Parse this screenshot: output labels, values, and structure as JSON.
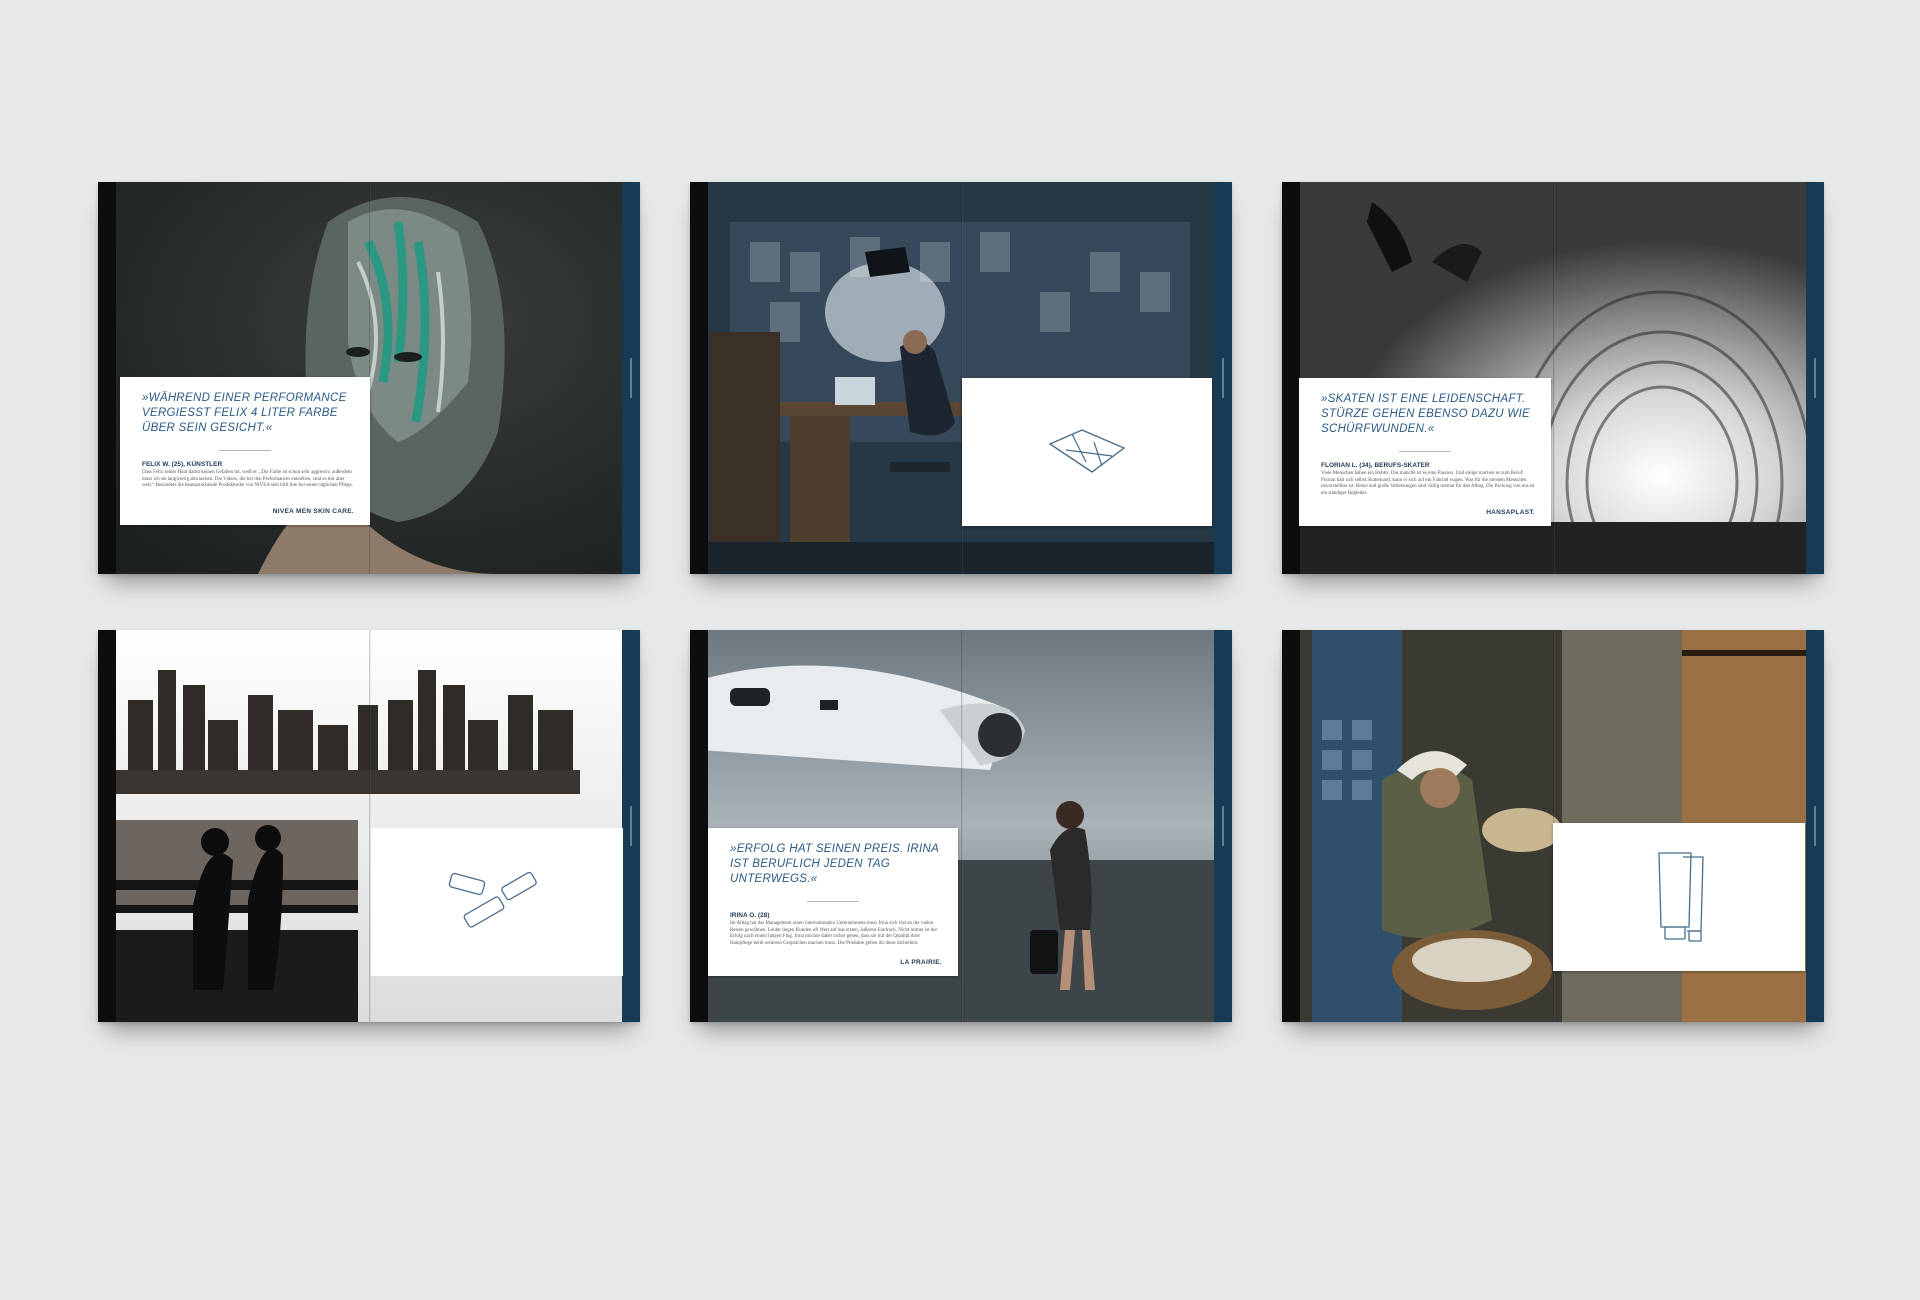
{
  "spreads": [
    {
      "quote": "»Während einer Performance vergiesst Felix 4 Liter Farbe über sein Gesicht.«",
      "who": "FELIX W. (25), KÜNSTLER",
      "body": "Dass Felix seiner Haut damit keinen Gefallen tut, weiß er. „Die Farbe ist schon sehr aggressiv, außerdem muss ich sie langwierig abwaschen. Die Videos, die bei den Performances entstehen, sind es mir aber wert.“ Besonders die beanspruchende Produktreihe von NIVEA sein hilft ihm bei seiner täglichen Pflege.",
      "brand": "NIVEA MEN SKIN CARE.",
      "icon": "none"
    },
    {
      "icon": "folded-paper-icon"
    },
    {
      "quote": "»Skaten ist eine Leidenschaft. Stürze gehen ebenso dazu wie Schürfwunden.«",
      "who": "FLORIAN L. (34), BERUFS-SKATER",
      "body": "Viele Menschen haben ein Hobby. Das manche ist es eine Passion. Und einige machen es zum Beruf: Florian hält sich selbst Skateboard, kann er sich auf ein Fahrrad wagen. Was für die meisten Menschen unvorstellbar ist: Beine und große Verletzungen sind völlig normal für den Alltag. Die Packung von uns ist ein ständiger Begleiter.",
      "brand": "HANSAPLAST.",
      "icon": "none"
    },
    {
      "icon": "lip-balm-sticks-icon"
    },
    {
      "quote": "»Erfolg hat seinen Preis. Irina ist beruflich jeden Tag unterwegs.«",
      "who": "IRINA O. (28)",
      "body": "Im Alltag hat das Management einen internationalen Unternehmens-muss Irina sich viel an der vielen Reisen gewöhnen. Leider liegen Kunden oft Wert auf das ersten, äußeren Eindruck. Nicht immer ist der Erfolg nach einem langen Flug. Irina möchte daher sicher gehen, dass sie mit der Qualität ihrer Hautpflege beim weiteren Gesprächen machen muss. Die Produkte geben ihr diese Sicherheit.",
      "brand": "LA PRAIRIE.",
      "icon": "none"
    },
    {
      "icon": "cream-tube-icon"
    }
  ]
}
